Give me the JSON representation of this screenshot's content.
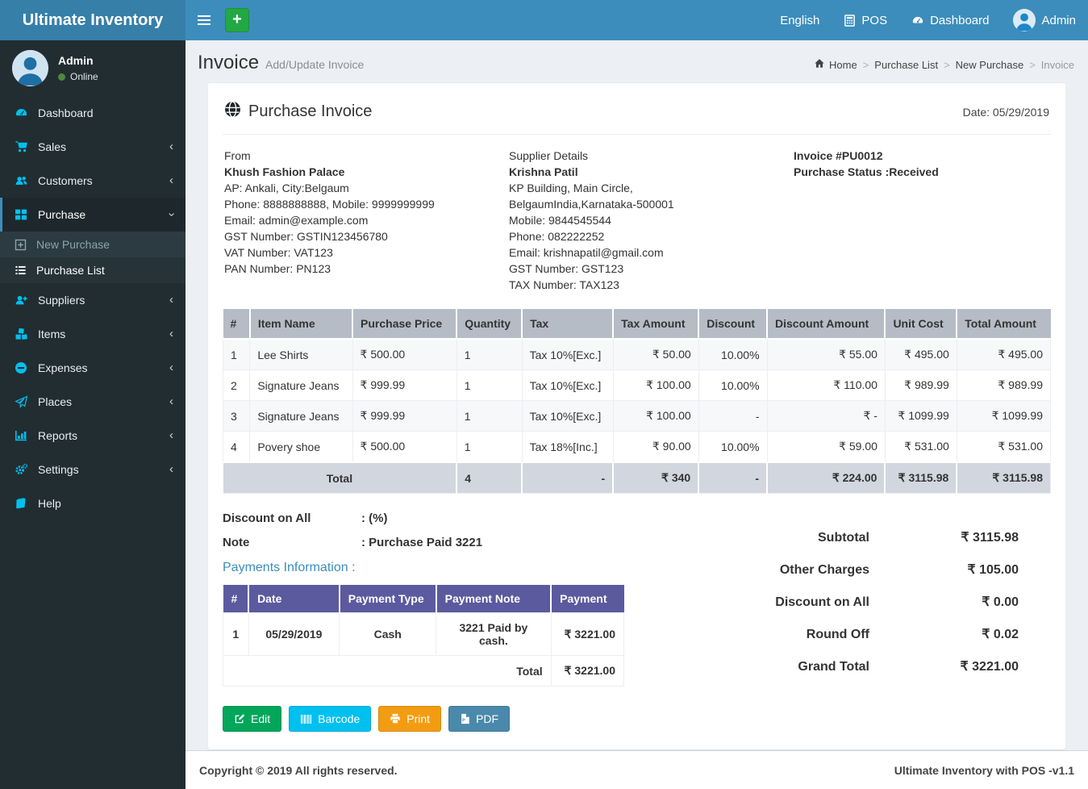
{
  "colors": {
    "navbar": "#3c8dbc",
    "logo_bg": "#367fa9",
    "sidebar": "#222d32",
    "sidebar_icon": "#00c0ef",
    "active_accent": "#3c8dbc",
    "items_header_bg": "#b6bcc6",
    "items_total_bg": "#d2d6de",
    "payments_header_bg": "#5b5a9f",
    "btn_edit": "#00a65a",
    "btn_barcode": "#00c0ef",
    "btn_print": "#f39c12",
    "btn_pdf": "#4a89ab"
  },
  "navbar": {
    "brand": "Ultimate Inventory",
    "language": "English",
    "pos": "POS",
    "dashboard": "Dashboard",
    "user": "Admin"
  },
  "sidebar": {
    "user_name": "Admin",
    "user_status": "Online",
    "items": [
      {
        "label": "Dashboard"
      },
      {
        "label": "Sales"
      },
      {
        "label": "Customers"
      },
      {
        "label": "Purchase"
      },
      {
        "label": "Suppliers"
      },
      {
        "label": "Items"
      },
      {
        "label": "Expenses"
      },
      {
        "label": "Places"
      },
      {
        "label": "Reports"
      },
      {
        "label": "Settings"
      },
      {
        "label": "Help"
      }
    ],
    "submenu": [
      {
        "label": "New Purchase"
      },
      {
        "label": "Purchase List"
      }
    ]
  },
  "page_header": {
    "title": "Invoice",
    "subtitle": "Add/Update Invoice",
    "breadcrumb": [
      "Home",
      "Purchase List",
      "New Purchase",
      "Invoice"
    ]
  },
  "invoice": {
    "box_title": "Purchase Invoice",
    "date": "Date: 05/29/2019",
    "from": {
      "heading": "From",
      "name": "Khush Fashion Palace",
      "lines": [
        "AP: Ankali, City:Belgaum",
        "Phone: 8888888888, Mobile: 9999999999",
        "Email: admin@example.com",
        "GST Number: GSTIN123456780",
        "VAT Number: VAT123",
        "PAN Number: PN123"
      ]
    },
    "supplier": {
      "heading": "Supplier Details",
      "name": "Krishna Patil",
      "lines": [
        "KP Building, Main Circle, BelgaumIndia,Karnataka-500001",
        "Mobile: 9844545544",
        "Phone: 082222252",
        "Email: krishnapatil@gmail.com",
        "GST Number: GST123",
        "TAX Number: TAX123"
      ]
    },
    "meta": {
      "invoice_no": "Invoice #PU0012",
      "status": "Purchase Status :Received"
    },
    "items_table": {
      "headers": [
        "#",
        "Item Name",
        "Purchase Price",
        "Quantity",
        "Tax",
        "Tax Amount",
        "Discount",
        "Discount Amount",
        "Unit Cost",
        "Total Amount"
      ],
      "rows": [
        {
          "num": "1",
          "name": "Lee Shirts",
          "price": "₹ 500.00",
          "qty": "1",
          "tax": "Tax 10%[Exc.]",
          "tax_amount": "₹ 50.00",
          "discount": "10.00%",
          "discount_amount": "₹ 55.00",
          "unit_cost": "₹ 495.00",
          "total": "₹ 495.00"
        },
        {
          "num": "2",
          "name": "Signature Jeans",
          "price": "₹ 999.99",
          "qty": "1",
          "tax": "Tax 10%[Exc.]",
          "tax_amount": "₹ 100.00",
          "discount": "10.00%",
          "discount_amount": "₹ 110.00",
          "unit_cost": "₹ 989.99",
          "total": "₹ 989.99"
        },
        {
          "num": "3",
          "name": "Signature Jeans",
          "price": "₹ 999.99",
          "qty": "1",
          "tax": "Tax 10%[Exc.]",
          "tax_amount": "₹ 100.00",
          "discount": "-",
          "discount_amount": "₹ -",
          "unit_cost": "₹ 1099.99",
          "total": "₹ 1099.99"
        },
        {
          "num": "4",
          "name": "Povery shoe",
          "price": "₹ 500.00",
          "qty": "1",
          "tax": "Tax 18%[Inc.]",
          "tax_amount": "₹ 90.00",
          "discount": "10.00%",
          "discount_amount": "₹ 59.00",
          "unit_cost": "₹ 531.00",
          "total": "₹ 531.00"
        }
      ],
      "total_row": {
        "label": "Total",
        "qty": "4",
        "tax": "-",
        "tax_amount": "₹ 340",
        "discount": "-",
        "discount_amount": "₹ 224.00",
        "unit_cost": "₹ 3115.98",
        "total": "₹ 3115.98"
      }
    },
    "discount_label": "Discount on All",
    "discount_value": ": (%)",
    "note_label": "Note",
    "note_value": ": Purchase Paid 3221",
    "payments_heading": "Payments Information :",
    "payments_table": {
      "headers": [
        "#",
        "Date",
        "Payment Type",
        "Payment Note",
        "Payment"
      ],
      "rows": [
        {
          "num": "1",
          "date": "05/29/2019",
          "type": "Cash",
          "note": "3221 Paid by cash.",
          "amount": "₹ 3221.00"
        }
      ],
      "total_label": "Total",
      "total_value": "₹ 3221.00"
    },
    "summary": [
      {
        "label": "Subtotal",
        "value": "₹ 3115.98"
      },
      {
        "label": "Other Charges",
        "value": "₹ 105.00"
      },
      {
        "label": "Discount on All",
        "value": "₹ 0.00"
      },
      {
        "label": "Round Off",
        "value": "₹ 0.02"
      },
      {
        "label": "Grand Total",
        "value": "₹ 3221.00"
      }
    ],
    "buttons": [
      {
        "label": "Edit"
      },
      {
        "label": "Barcode"
      },
      {
        "label": "Print"
      },
      {
        "label": "PDF"
      }
    ]
  },
  "footer": {
    "left": "Copyright © 2019 All rights reserved.",
    "right": "Ultimate Inventory with POS -v1.1"
  }
}
